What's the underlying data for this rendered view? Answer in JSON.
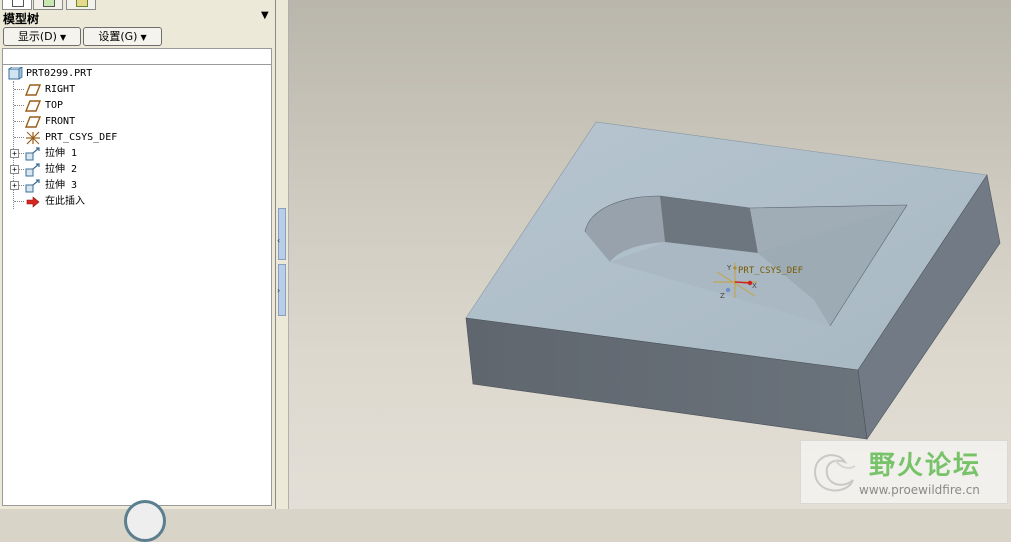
{
  "panel": {
    "title": "模型树",
    "menu_icon": "dropdown-triangle",
    "display_button": "显示(D)",
    "settings_button": "设置(G)",
    "tabs": [
      {
        "icon": "model-tree-tab-icon"
      },
      {
        "icon": "folder-browser-tab-icon"
      },
      {
        "icon": "favorites-tab-icon"
      }
    ]
  },
  "tree": {
    "root": {
      "label": "PRT0299.PRT",
      "icon": "part-icon"
    },
    "items": [
      {
        "label": "RIGHT",
        "icon": "datum-plane-icon",
        "expandable": false
      },
      {
        "label": "TOP",
        "icon": "datum-plane-icon",
        "expandable": false
      },
      {
        "label": "FRONT",
        "icon": "datum-plane-icon",
        "expandable": false
      },
      {
        "label": "PRT_CSYS_DEF",
        "icon": "csys-icon",
        "expandable": false
      },
      {
        "label": "拉伸 1",
        "icon": "extrude-icon",
        "expandable": true
      },
      {
        "label": "拉伸 2",
        "icon": "extrude-icon",
        "expandable": true
      },
      {
        "label": "拉伸 3",
        "icon": "extrude-icon",
        "expandable": true
      },
      {
        "label": "在此插入",
        "icon": "insert-here-arrow-icon",
        "expandable": false
      }
    ]
  },
  "viewport": {
    "csys_label": "PRT_CSYS_DEF",
    "axes": {
      "x": "X",
      "y": "Y",
      "z": "Z"
    }
  },
  "watermark": {
    "title": "野火论坛",
    "url": "www.proewildfire.cn"
  },
  "colors": {
    "model_top": "#aebfca",
    "model_front": "#636a72",
    "model_right": "#6f7882",
    "background_top": "#b9b6ab",
    "background_bottom": "#e3dfd6",
    "watermark_green": "#78c26a"
  }
}
